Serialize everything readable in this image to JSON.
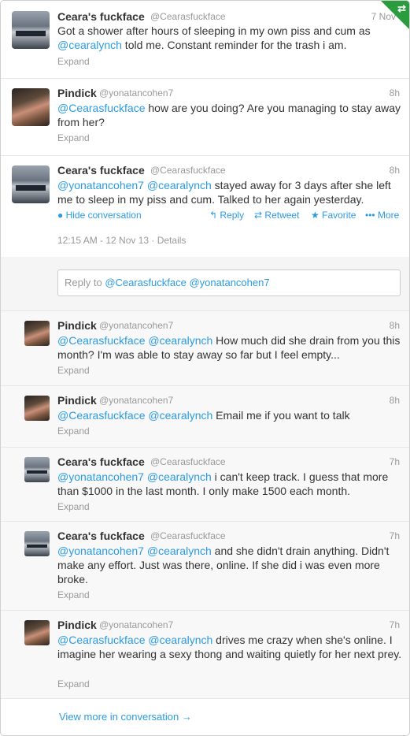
{
  "tweets": [
    {
      "name": "Ceara's fuckface",
      "handle": "@Cearasfuckface",
      "time": "7 Nov",
      "body": [
        {
          "t": "Got a shower after hours of sleeping in my own piss and cum as "
        },
        {
          "m": "@cearalynch"
        },
        {
          "t": " told me. Constant reminder for the trash i am."
        }
      ],
      "expand": "Expand"
    },
    {
      "name": "Pindick",
      "handle": "@yonatancohen7",
      "time": "8h",
      "body": [
        {
          "m": "@Cearasfuckface"
        },
        {
          "t": " how are you doing? Are you managing to stay away from her?"
        }
      ],
      "expand": "Expand"
    },
    {
      "name": "Ceara's fuckface",
      "handle": "@Cearasfuckface",
      "time": "8h",
      "body": [
        {
          "m": "@yonatancohen7"
        },
        {
          "t": " "
        },
        {
          "m": "@cearalynch"
        },
        {
          "t": " stayed away for 3 days after she left me to sleep in my piss and cum. Talked to her again yesterday."
        }
      ],
      "actions": {
        "hide": "Hide conversation",
        "reply": "Reply",
        "retweet": "Retweet",
        "favorite": "Favorite",
        "more": "More"
      },
      "meta": "12:15 AM - 12 Nov 13 · Details"
    }
  ],
  "reply_box": {
    "prefix": "Reply to ",
    "mention1": "@Cearasfuckface",
    "mention2": "@yonatancohen7"
  },
  "replies": [
    {
      "name": "Pindick",
      "handle": "@yonatancohen7",
      "time": "8h",
      "body": [
        {
          "m": "@Cearasfuckface"
        },
        {
          "t": " "
        },
        {
          "m": "@cearalynch"
        },
        {
          "t": " How much did she drain from you this month? I'm was able to stay away so far but I feel empty..."
        }
      ],
      "expand": "Expand"
    },
    {
      "name": "Pindick",
      "handle": "@yonatancohen7",
      "time": "8h",
      "body": [
        {
          "m": "@Cearasfuckface"
        },
        {
          "t": " "
        },
        {
          "m": "@cearalynch"
        },
        {
          "t": " Email me if you want to talk"
        }
      ],
      "expand": "Expand"
    },
    {
      "name": "Ceara's fuckface",
      "handle": "@Cearasfuckface",
      "time": "7h",
      "body": [
        {
          "m": "@yonatancohen7"
        },
        {
          "t": " "
        },
        {
          "m": "@cearalynch"
        },
        {
          "t": " i can't keep track. I guess that more than $1000 in the last month. I only make 1500 each month."
        }
      ],
      "expand": "Expand"
    },
    {
      "name": "Ceara's fuckface",
      "handle": "@Cearasfuckface",
      "time": "7h",
      "body": [
        {
          "m": "@yonatancohen7"
        },
        {
          "t": " "
        },
        {
          "m": "@cearalynch"
        },
        {
          "t": " and she didn't drain anything. Didn't make any effort. Just was there, online. If she did i was even more broke."
        }
      ],
      "expand": "Expand"
    },
    {
      "name": "Pindick",
      "handle": "@yonatancohen7",
      "time": "7h",
      "body": [
        {
          "m": "@Cearasfuckface"
        },
        {
          "t": " "
        },
        {
          "m": "@cearalynch"
        },
        {
          "t": " drives me crazy when she's online. I imagine her wearing a sexy thong and waiting quietly for her next prey."
        }
      ],
      "expand": "Expand"
    }
  ],
  "footer": {
    "view_more": "View more in conversation →"
  },
  "colors": {
    "link": "#2b9be0",
    "muted": "#999999",
    "corner_badge": "#2a9c3d"
  },
  "icons": {
    "corner": "retweet-badge-icon",
    "hide": "speech-bubble-icon",
    "reply": "reply-arrow-icon",
    "retweet": "retweet-icon",
    "favorite": "star-icon",
    "more": "ellipsis-icon"
  }
}
